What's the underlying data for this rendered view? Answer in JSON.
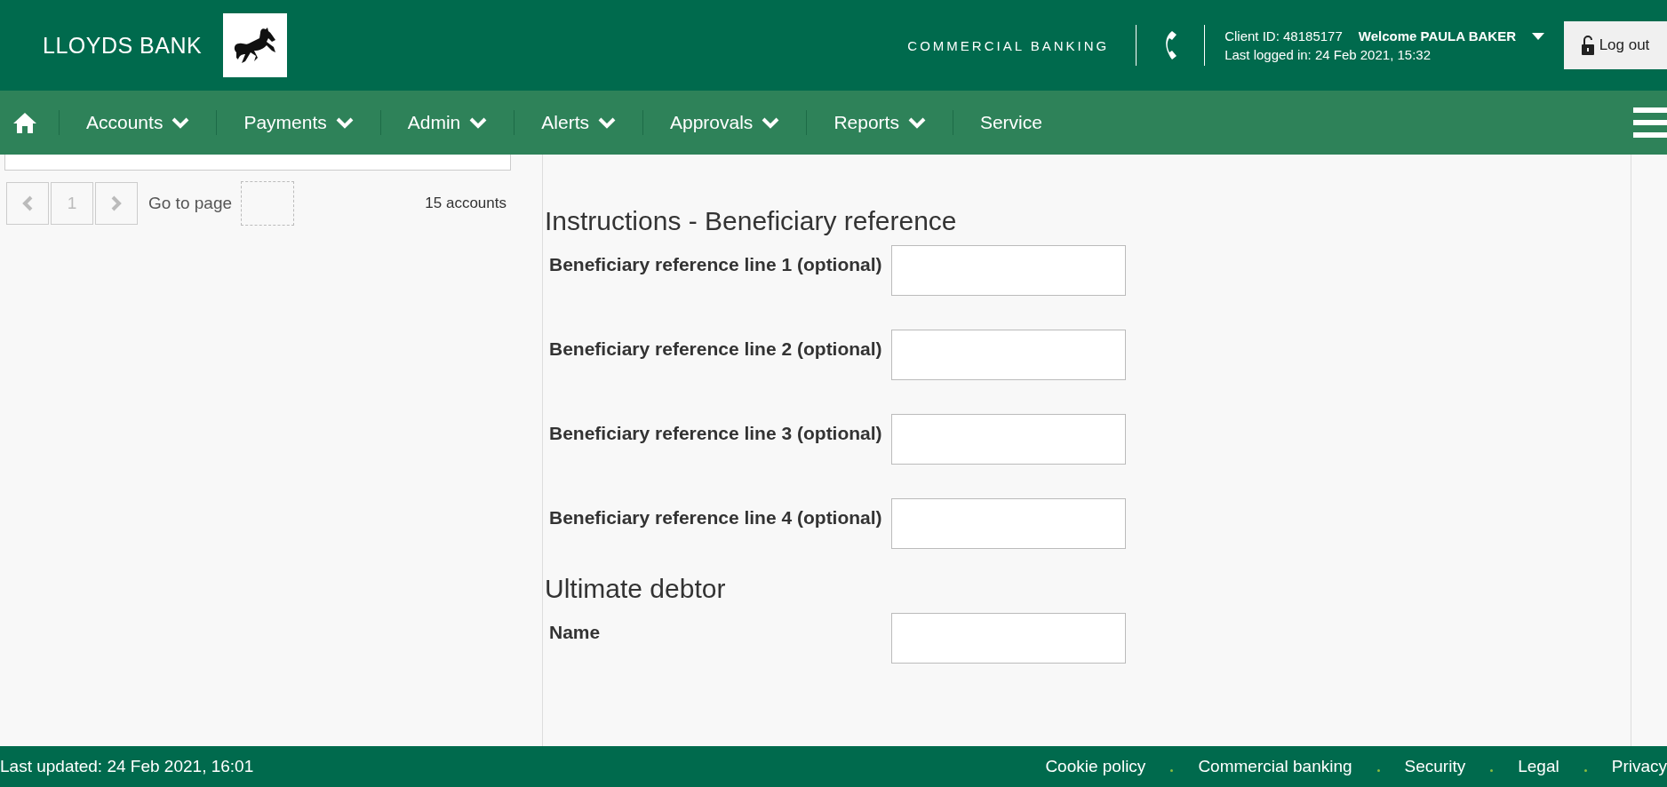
{
  "header": {
    "brand": "LLOYDS BANK",
    "segment": "COMMERCIAL BANKING",
    "client_id": "Client ID: 48185177",
    "welcome": "Welcome PAULA BAKER",
    "last_logged": "Last logged in: 24 Feb 2021, 15:32",
    "logout": "Log out"
  },
  "nav": [
    {
      "label": "Accounts",
      "dropdown": true
    },
    {
      "label": "Payments",
      "dropdown": true
    },
    {
      "label": "Admin",
      "dropdown": true
    },
    {
      "label": "Alerts",
      "dropdown": true
    },
    {
      "label": "Approvals",
      "dropdown": true
    },
    {
      "label": "Reports",
      "dropdown": true
    },
    {
      "label": "Service",
      "dropdown": false
    }
  ],
  "pagination": {
    "prev_disabled": true,
    "page": "1",
    "goto_label": "Go to page",
    "count": "15 accounts"
  },
  "sections": [
    {
      "title": "Instructions - Beneficiary reference",
      "fields": [
        {
          "label": "Beneficiary reference line 1 (optional)"
        },
        {
          "label": "Beneficiary reference line 2 (optional)"
        },
        {
          "label": "Beneficiary reference line 3 (optional)"
        },
        {
          "label": "Beneficiary reference line 4 (optional)"
        }
      ]
    },
    {
      "title": "Ultimate debtor",
      "fields": [
        {
          "label": "Name"
        }
      ]
    }
  ],
  "footer": {
    "updated": "Last updated: 24 Feb 2021, 16:01",
    "links": [
      "Cookie policy",
      "Commercial banking",
      "Security",
      "Legal",
      "Privacy"
    ]
  }
}
